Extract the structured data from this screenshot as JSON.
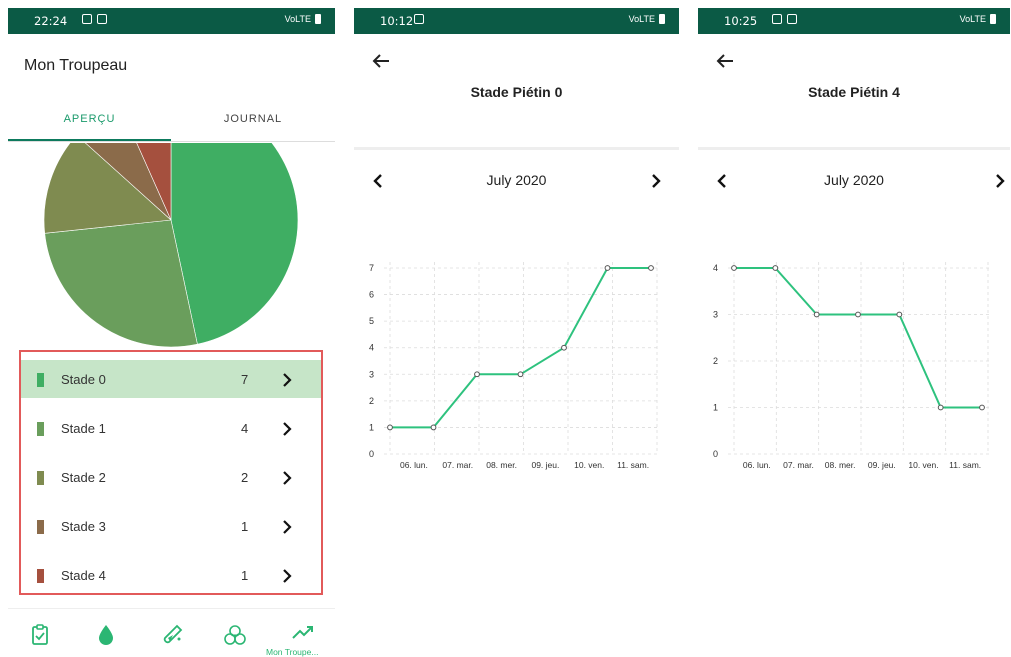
{
  "screen1": {
    "status_time": "22:24",
    "status_right": "VoLTE",
    "app_title": "Mon Troupeau",
    "tabs": [
      {
        "label": "APERÇU"
      },
      {
        "label": "JOURNAL"
      }
    ],
    "stages": [
      {
        "label": "Stade 0",
        "count": "7",
        "color": "#3fae63",
        "value": 7
      },
      {
        "label": "Stade 1",
        "count": "4",
        "color": "#6a9e5c",
        "value": 4
      },
      {
        "label": "Stade 2",
        "count": "2",
        "color": "#7f8b50",
        "value": 2
      },
      {
        "label": "Stade 3",
        "count": "1",
        "color": "#8b6b4a",
        "value": 1
      },
      {
        "label": "Stade 4",
        "count": "1",
        "color": "#a5503e",
        "value": 1
      }
    ],
    "selected_index": 0,
    "bottom_nav": [
      {
        "icon": "clipboard-check-icon"
      },
      {
        "icon": "drop-icon"
      },
      {
        "icon": "test-tube-icon"
      },
      {
        "icon": "biohazard-icon"
      },
      {
        "icon": "trending-up-icon",
        "label": "Mon Troupe..."
      }
    ]
  },
  "screen2": {
    "status_time": "10:12",
    "status_right": "VoLTE",
    "title": "Stade Piétin 0",
    "month": "July 2020"
  },
  "screen3": {
    "status_time": "10:25",
    "status_right": "VoLTE",
    "title": "Stade Piétin 4",
    "month": "July 2020"
  },
  "colors": {
    "accent": "#2bb673",
    "statusbar": "#0b5a45",
    "line": "#2ec27e",
    "highlight_border": "#e25a5a",
    "selected_row": "#c6e5c8"
  },
  "chart_data": [
    {
      "type": "line",
      "categories": [
        "06. lun.",
        "07. mar.",
        "08. mer.",
        "09. jeu.",
        "10. ven.",
        "11. sam."
      ],
      "x": [
        0,
        1,
        2,
        3,
        4,
        5,
        6,
        7
      ],
      "values": [
        1,
        1,
        3,
        3,
        4,
        7,
        7
      ],
      "yticks": [
        "0",
        "1",
        "2",
        "3",
        "4",
        "5",
        "6",
        "7"
      ],
      "ylim": [
        0,
        7
      ],
      "grid": true
    },
    {
      "type": "line",
      "categories": [
        "06. lun.",
        "07. mar.",
        "08. mer.",
        "09. jeu.",
        "10. ven.",
        "11. sam."
      ],
      "values": [
        4,
        4,
        3,
        3,
        3,
        1,
        1
      ],
      "yticks": [
        "0",
        "1",
        "2",
        "3",
        "4"
      ],
      "ylim": [
        0,
        4
      ],
      "grid": true
    }
  ]
}
